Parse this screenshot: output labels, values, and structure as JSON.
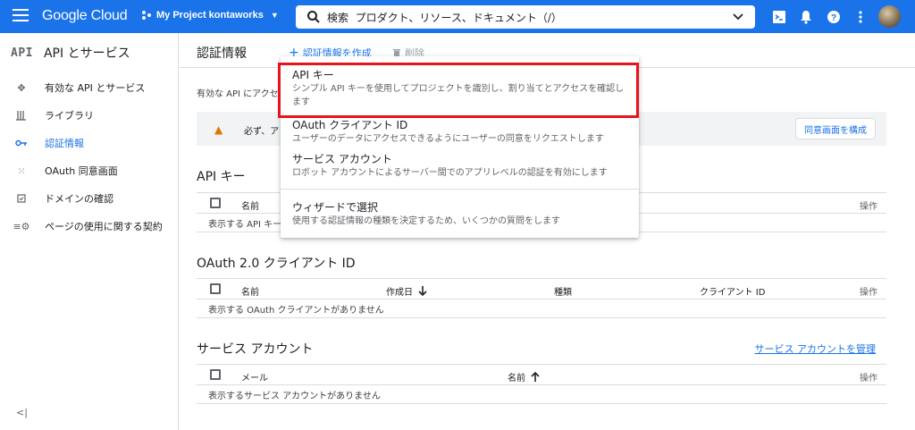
{
  "topbar": {
    "logo": "Google Cloud",
    "project": "My Project kontaworks",
    "search_label": "検索",
    "search_placeholder": "プロダクト、リソース、ドキュメント（/）"
  },
  "sidebar": {
    "badge": "API",
    "title": "API とサービス",
    "items": [
      {
        "label": "有効な API とサービス",
        "icon": "diamond-cross-icon"
      },
      {
        "label": "ライブラリ",
        "icon": "library-icon"
      },
      {
        "label": "認証情報",
        "icon": "key-icon"
      },
      {
        "label": "OAuth 同意画面",
        "icon": "dots-grid-icon"
      },
      {
        "label": "ドメインの確認",
        "icon": "checkbox-icon"
      },
      {
        "label": "ページの使用に関する契約",
        "icon": "settings-list-icon"
      }
    ],
    "collapse": "<|"
  },
  "main": {
    "title": "認証情報",
    "create_label": "認証情報を作成",
    "delete_label": "削除",
    "description": "有効な API にアクセ",
    "warning_text": "必ず、ア",
    "consent_button": "同意画面を構成"
  },
  "api_keys": {
    "title": "API キー",
    "col_name": "名前",
    "col_actions": "操作",
    "empty": "表示する API キー"
  },
  "oauth": {
    "title": "OAuth 2.0 クライアント ID",
    "col_name": "名前",
    "col_created": "作成日",
    "col_type": "種類",
    "col_client_id": "クライアント ID",
    "col_actions": "操作",
    "empty": "表示する OAuth クライアントがありません"
  },
  "service_accounts": {
    "title": "サービス アカウント",
    "manage_link": "サービス アカウントを管理",
    "col_email": "メール",
    "col_name": "名前",
    "col_actions": "操作",
    "empty": "表示するサービス アカウントがありません"
  },
  "menu": {
    "items": [
      {
        "title": "API キー",
        "desc": "シンプル API キーを使用してプロジェクトを識別し、割り当てとアクセスを確認します"
      },
      {
        "title": "OAuth クライアント ID",
        "desc": "ユーザーのデータにアクセスできるようにユーザーの同意をリクエストします"
      },
      {
        "title": "サービス アカウント",
        "desc": "ロボット アカウントによるサーバー間でのアプリレベルの認証を有効にします"
      },
      {
        "title": "ウィザードで選択",
        "desc": "使用する認証情報の種類を決定するため、いくつかの質問をします"
      }
    ]
  },
  "colors": {
    "topbar": "#1a73e8",
    "accent": "#1a73e8",
    "highlight_border": "#e8131b",
    "warning": "#e37400"
  }
}
